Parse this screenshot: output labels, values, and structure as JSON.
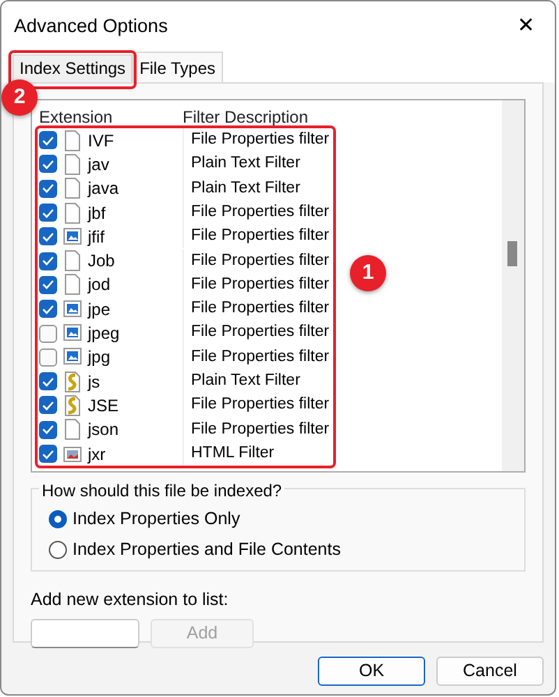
{
  "window": {
    "title": "Advanced Options",
    "close": "✕"
  },
  "tabs": [
    {
      "label": "Index Settings",
      "selected": false
    },
    {
      "label": "File Types",
      "selected": true
    }
  ],
  "table": {
    "columns": [
      "Extension",
      "Filter Description"
    ],
    "rows": [
      {
        "checked": true,
        "kind": "blank",
        "extension": "IVF",
        "filter": "File Properties filter"
      },
      {
        "checked": true,
        "kind": "blank",
        "extension": "jav",
        "filter": "Plain Text Filter"
      },
      {
        "checked": true,
        "kind": "blank",
        "extension": "java",
        "filter": "Plain Text Filter"
      },
      {
        "checked": true,
        "kind": "blank",
        "extension": "jbf",
        "filter": "File Properties filter"
      },
      {
        "checked": true,
        "kind": "image",
        "extension": "jfif",
        "filter": "File Properties filter"
      },
      {
        "checked": true,
        "kind": "blank",
        "extension": "Job",
        "filter": "File Properties filter"
      },
      {
        "checked": true,
        "kind": "blank",
        "extension": "jod",
        "filter": "File Properties filter"
      },
      {
        "checked": true,
        "kind": "image",
        "extension": "jpe",
        "filter": "File Properties filter"
      },
      {
        "checked": false,
        "kind": "image",
        "extension": "jpeg",
        "filter": "File Properties filter"
      },
      {
        "checked": false,
        "kind": "image",
        "extension": "jpg",
        "filter": "File Properties filter"
      },
      {
        "checked": true,
        "kind": "script",
        "extension": "js",
        "filter": "Plain Text Filter"
      },
      {
        "checked": true,
        "kind": "script",
        "extension": "JSE",
        "filter": "File Properties filter"
      },
      {
        "checked": true,
        "kind": "blank",
        "extension": "json",
        "filter": "File Properties filter"
      },
      {
        "checked": true,
        "kind": "photo",
        "extension": "jxr",
        "filter": "HTML Filter"
      }
    ]
  },
  "index_group": {
    "title": "How should this file be indexed?",
    "options": [
      {
        "label": "Index Properties Only",
        "selected": true
      },
      {
        "label": "Index Properties and File Contents",
        "selected": false
      }
    ]
  },
  "add_extension": {
    "label": "Add new extension to list:",
    "button": "Add",
    "disabled": true
  },
  "buttons": [
    {
      "label": "OK",
      "default": true
    },
    {
      "label": "Cancel",
      "default": false
    }
  ],
  "tab_callout": {
    "label": "2"
  },
  "list_callout": {
    "label": "1"
  }
}
